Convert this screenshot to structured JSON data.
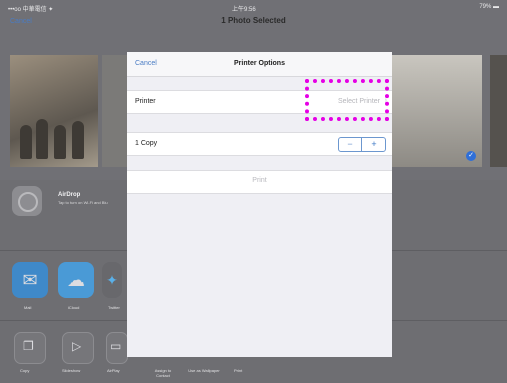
{
  "status_bar": {
    "left": "•••oo 中華電信 ✦",
    "center": "上午9:56",
    "right": "79% ▬"
  },
  "nav": {
    "cancel": "Cancel",
    "title": "1 Photo Selected"
  },
  "share": {
    "airdrop_title": "AirDrop",
    "airdrop_subtitle": "Tap to turn on Wi-Fi and Blu",
    "apps": [
      "Mail",
      "iCloud",
      "Twitter"
    ],
    "actions": [
      "Copy",
      "Slideshow",
      "AirPlay",
      "Assign to Contact",
      "Use as Wallpaper",
      "Print"
    ]
  },
  "printer_options": {
    "cancel": "Cancel",
    "title": "Printer Options",
    "printer_label": "Printer",
    "printer_value": "Select Printer",
    "chevron": "›",
    "copies_label": "1 Copy",
    "minus": "−",
    "plus": "+",
    "print_button": "Print"
  },
  "colors": {
    "accent": "#4a7cc4",
    "highlight": "#e500e5",
    "check": "#2f6fd8"
  }
}
